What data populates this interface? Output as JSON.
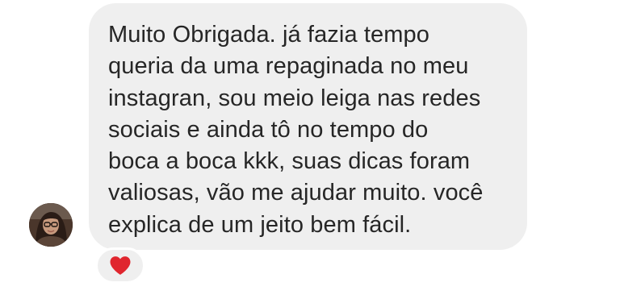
{
  "message": {
    "text": "Muito Obrigada. já fazia tempo\nqueria da uma repaginada no meu\ninstagran, sou meio leiga nas redes\nsociais e ainda tô no tempo do\nboca a boca kkk, suas dicas foram\nvaliosas, vão me ajudar muito. você\nexplica de um jeito bem fácil.",
    "bubble_color": "#efefef",
    "text_color": "#262626"
  },
  "sender": {
    "avatar_icon": "profile-photo"
  },
  "reaction": {
    "icon": "heart-icon",
    "color": "#e0262e"
  }
}
